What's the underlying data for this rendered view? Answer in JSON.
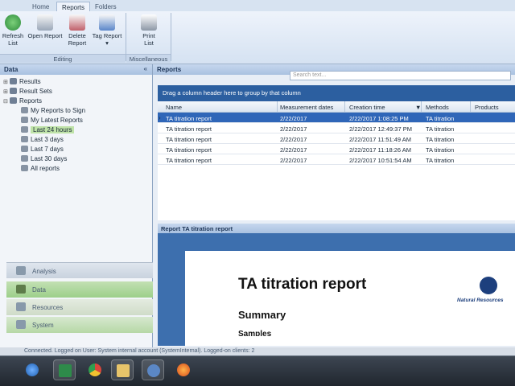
{
  "ribbon": {
    "tabs": [
      "Home",
      "Reports",
      "Folders"
    ],
    "active_tab": "Reports",
    "buttons": [
      {
        "label": "Refresh\nList",
        "icon": "refresh-icon"
      },
      {
        "label": "Open Report",
        "icon": "open-report-icon"
      },
      {
        "label": "Delete\nReport",
        "icon": "delete-report-icon"
      },
      {
        "label": "Tag Report\n▾",
        "icon": "tag-report-icon"
      },
      {
        "label": "Print\nList",
        "icon": "printer-icon"
      }
    ],
    "groups": [
      "Editing",
      "Miscellaneous"
    ]
  },
  "left_pane": {
    "title": "Data",
    "collapse": "«",
    "tree": [
      {
        "label": "Results",
        "icon": "results-icon",
        "expander": "⊞"
      },
      {
        "label": "Result Sets",
        "icon": "result-sets-icon",
        "expander": "⊞"
      },
      {
        "label": "Reports",
        "icon": "reports-icon",
        "expander": "⊟"
      },
      {
        "label": "My Reports to Sign",
        "icon": "filter-icon"
      },
      {
        "label": "My Latest Reports",
        "icon": "filter-icon"
      },
      {
        "label": "Last 24 hours",
        "icon": "filter-icon",
        "selected": true
      },
      {
        "label": "Last 3 days",
        "icon": "filter-icon"
      },
      {
        "label": "Last 7 days",
        "icon": "filter-icon"
      },
      {
        "label": "Last 30 days",
        "icon": "filter-icon"
      },
      {
        "label": "All reports",
        "icon": "filter-icon"
      }
    ],
    "nav": [
      "Analysis",
      "Data",
      "Resources",
      "System"
    ]
  },
  "reports": {
    "title": "Reports",
    "search_placeholder": "Search text...",
    "group_hint": "Drag a column header here to group by that column",
    "columns": [
      "Name",
      "Measurement dates",
      "Creation time",
      "Methods",
      "Products"
    ],
    "sort_indicator": "▼",
    "rows": [
      {
        "name": "TA titration report",
        "measurement": "2/22/2017",
        "created": "2/22/2017 1:08:25 PM",
        "method": "TA titration",
        "product": ""
      },
      {
        "name": "TA titration report",
        "measurement": "2/22/2017",
        "created": "2/22/2017 12:49:37 PM",
        "method": "TA titration",
        "product": ""
      },
      {
        "name": "TA titration report",
        "measurement": "2/22/2017",
        "created": "2/22/2017 11:51:49 AM",
        "method": "TA titration",
        "product": ""
      },
      {
        "name": "TA titration report",
        "measurement": "2/22/2017",
        "created": "2/22/2017 11:18:26 AM",
        "method": "TA titration",
        "product": ""
      },
      {
        "name": "TA titration report",
        "measurement": "2/22/2017",
        "created": "2/22/2017 10:51:54 AM",
        "method": "TA titration",
        "product": ""
      }
    ]
  },
  "preview": {
    "header": "Report TA titration report",
    "doc_title": "TA titration report",
    "section": "Summary",
    "subsection": "Samples",
    "logo_text": "Natural Resources"
  },
  "status": {
    "text": "Connected. Logged on User: System internal account (SystemInternal). Logged-on clients: 2"
  },
  "taskbar": {
    "items": [
      "start-orb-icon",
      "excel-icon",
      "chrome-icon",
      "folder-icon",
      "app-icon",
      "firefox-icon"
    ]
  }
}
